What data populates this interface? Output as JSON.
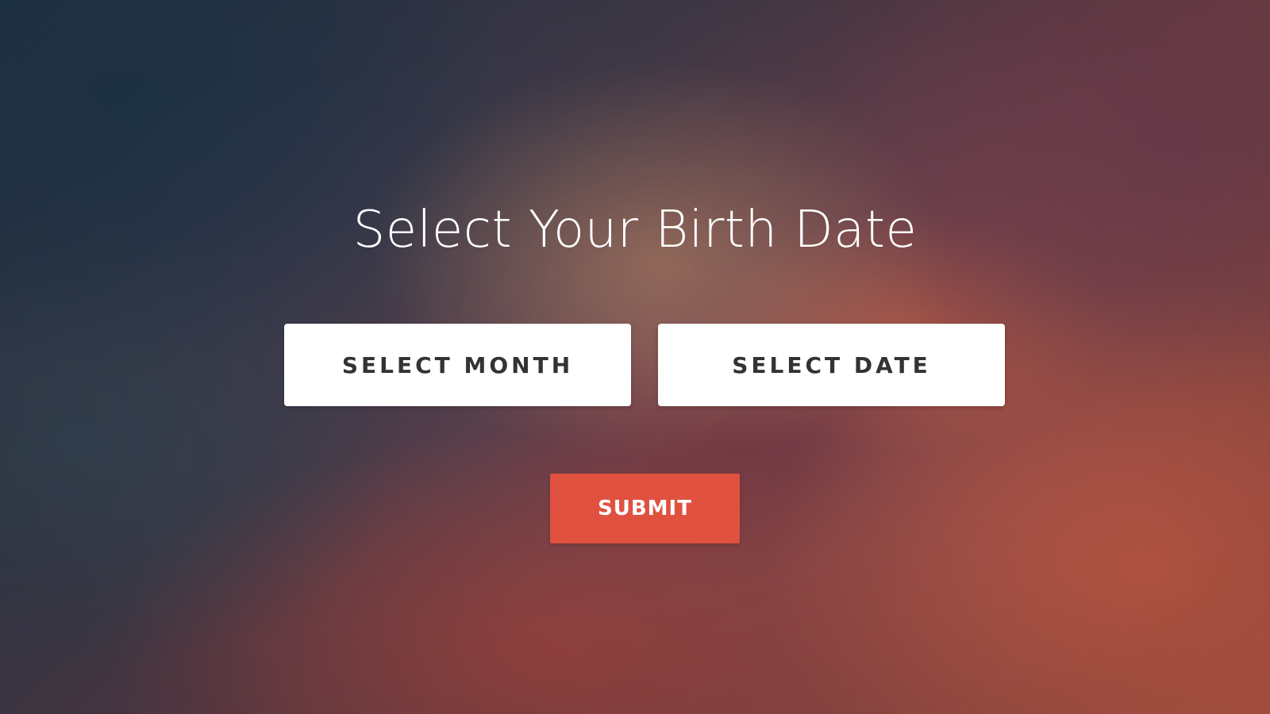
{
  "page": {
    "title": "Select Your Birth Date"
  },
  "form": {
    "month_label": "SELECT MONTH",
    "date_label": "SELECT DATE",
    "submit_label": "SUBMIT"
  },
  "colors": {
    "submit_bg": "#e05140",
    "select_bg": "#ffffff",
    "select_text": "#333333",
    "title_text": "#ffffff"
  }
}
